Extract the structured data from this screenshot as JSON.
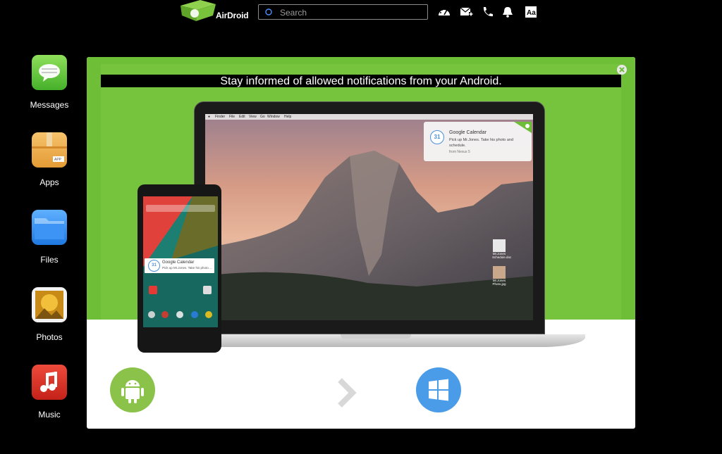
{
  "app": {
    "brand": "AirDroid"
  },
  "search": {
    "placeholder": "Search"
  },
  "toolbar": {
    "icons": [
      "speedometer-icon",
      "compose-mail-icon",
      "phone-icon",
      "bell-icon",
      "font-size-icon"
    ]
  },
  "dock": {
    "items": [
      {
        "label": "Messages",
        "icon": "messages-icon"
      },
      {
        "label": "Apps",
        "icon": "apps-icon"
      },
      {
        "label": "Files",
        "icon": "files-icon"
      },
      {
        "label": "Photos",
        "icon": "photos-icon"
      },
      {
        "label": "Music",
        "icon": "music-icon"
      }
    ]
  },
  "panel": {
    "headline": "Stay informed of allowed notifications from your Android."
  },
  "mac": {
    "menubar": [
      "Finder",
      "File",
      "Edit",
      "View",
      "Go",
      "Window",
      "Help"
    ],
    "notification": {
      "title": "Google Calendar",
      "text": "Pick up Mr.Jones. Take his photo and schedule.",
      "time": "from Nexus 5",
      "badge": "31"
    }
  },
  "phone": {
    "notification": {
      "title": "Google Calendar",
      "text": "Pick up Mr.Jones. Take his photo ...",
      "badge": "31"
    }
  },
  "colors": {
    "green": "#6ebe38",
    "android": "#8bc34a",
    "windows": "#4a9be8"
  }
}
